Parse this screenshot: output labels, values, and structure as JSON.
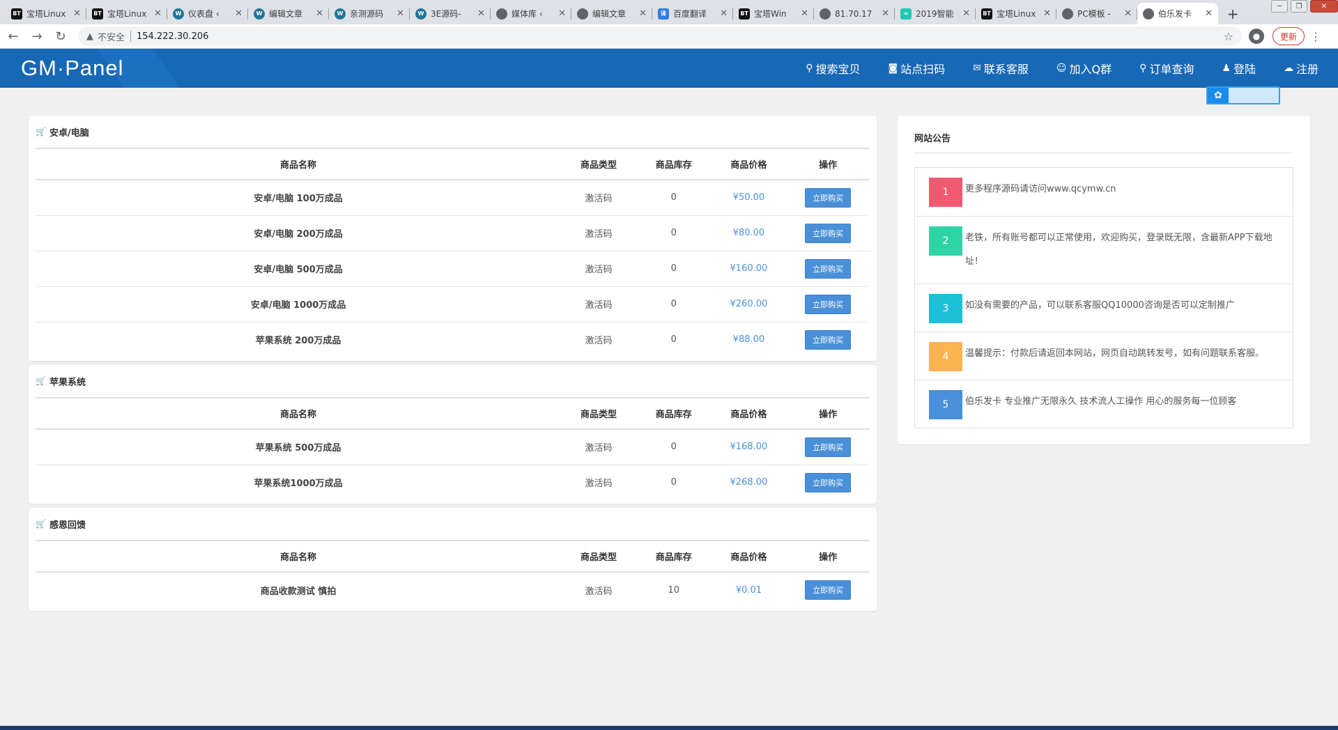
{
  "browser": {
    "tabs": [
      {
        "icon": "bt",
        "title": "宝塔Linux"
      },
      {
        "icon": "bt",
        "title": "宝塔Linux"
      },
      {
        "icon": "wp",
        "title": "仪表盘 ‹"
      },
      {
        "icon": "wp",
        "title": "编辑文章"
      },
      {
        "icon": "wp",
        "title": "亲测源码"
      },
      {
        "icon": "wp",
        "title": "3E源码-"
      },
      {
        "icon": "globe",
        "title": "媒体库 ‹"
      },
      {
        "icon": "globe",
        "title": "编辑文章"
      },
      {
        "icon": "baidu",
        "title": "百度翻译"
      },
      {
        "icon": "bt",
        "title": "宝塔Win"
      },
      {
        "icon": "globe",
        "title": "81.70.17"
      },
      {
        "icon": "teal",
        "title": "2019智能"
      },
      {
        "icon": "bt",
        "title": "宝塔Linux"
      },
      {
        "icon": "globe",
        "title": "PC模板 -"
      },
      {
        "icon": "globe",
        "title": "伯乐发卡"
      }
    ],
    "address": {
      "security_label": "不安全",
      "url": "154.222.30.206"
    },
    "update_label": "更新"
  },
  "navbar": {
    "brand": "GM·Panel",
    "links": [
      {
        "icon": "search-icon",
        "label": "搜索宝贝"
      },
      {
        "icon": "qr-icon",
        "label": "站点扫码"
      },
      {
        "icon": "chat-icon",
        "label": "联系客服"
      },
      {
        "icon": "group-icon",
        "label": "加入Q群"
      },
      {
        "icon": "search-icon",
        "label": "订单查询"
      },
      {
        "icon": "user-icon",
        "label": "登陆"
      },
      {
        "icon": "cloud-icon",
        "label": "注册"
      }
    ]
  },
  "table_headers": {
    "name": "商品名称",
    "type": "商品类型",
    "stock": "商品库存",
    "price": "商品价格",
    "action": "操作"
  },
  "categories": [
    {
      "title": "安卓/电脑",
      "items": [
        {
          "name": "安卓/电脑 100万成品",
          "type": "激活码",
          "stock": "0",
          "price": "¥50.00",
          "action": "立即购买"
        },
        {
          "name": "安卓/电脑 200万成品",
          "type": "激活码",
          "stock": "0",
          "price": "¥80.00",
          "action": "立即购买"
        },
        {
          "name": "安卓/电脑 500万成品",
          "type": "激活码",
          "stock": "0",
          "price": "¥160.00",
          "action": "立即购买"
        },
        {
          "name": "安卓/电脑 1000万成品",
          "type": "激活码",
          "stock": "0",
          "price": "¥260.00",
          "action": "立即购买"
        },
        {
          "name": "苹果系统 200万成品",
          "type": "激活码",
          "stock": "0",
          "price": "¥88.00",
          "action": "立即购买"
        }
      ]
    },
    {
      "title": "苹果系统",
      "items": [
        {
          "name": "苹果系统 500万成品",
          "type": "激活码",
          "stock": "0",
          "price": "¥168.00",
          "action": "立即购买"
        },
        {
          "name": "苹果系统1000万成品",
          "type": "激活码",
          "stock": "0",
          "price": "¥268.00",
          "action": "立即购买"
        }
      ]
    },
    {
      "title": "感恩回馈",
      "items": [
        {
          "name": "商品收款测试 慎拍",
          "type": "激活码",
          "stock": "10",
          "price": "¥0.01",
          "action": "立即购买"
        }
      ]
    }
  ],
  "announcement": {
    "title": "网站公告",
    "items": [
      {
        "num": "1",
        "color": "#f05a70",
        "text": "更多程序源码请访问www.qcymw.cn"
      },
      {
        "num": "2",
        "color": "#2fd4a6",
        "text": "老铁，所有账号都可以正常使用，欢迎购买，登录既无限，含最新APP下载地址！"
      },
      {
        "num": "3",
        "color": "#1cc0d8",
        "text": "如没有需要的产品，可以联系客服QQ10000咨询是否可以定制推广"
      },
      {
        "num": "4",
        "color": "#fbb451",
        "text": "温馨提示：付款后请返回本网站，网页自动跳转发号，如有问题联系客服。"
      },
      {
        "num": "5",
        "color": "#4a90d9",
        "text": "伯乐发卡 专业推广无限永久 技术流人工操作 用心的服务每一位顾客"
      }
    ]
  }
}
